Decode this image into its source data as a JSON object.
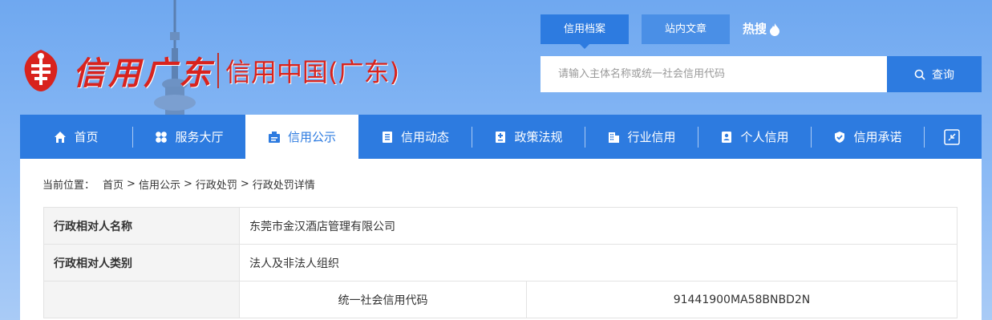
{
  "logo": {
    "main_text": "信用广东",
    "sub_text": "信用中国(广东)"
  },
  "search": {
    "tabs": [
      {
        "label": "信用档案",
        "active": true
      },
      {
        "label": "站内文章",
        "active": false
      }
    ],
    "hot_label": "热搜",
    "placeholder": "请输入主体名称或统一社会信用代码",
    "button_label": "查询"
  },
  "nav": {
    "items": [
      {
        "label": "首页",
        "icon": "home-icon"
      },
      {
        "label": "服务大厅",
        "icon": "grid-icon"
      },
      {
        "label": "信用公示",
        "icon": "announcement-icon",
        "active": true
      },
      {
        "label": "信用动态",
        "icon": "document-icon"
      },
      {
        "label": "政策法规",
        "icon": "law-icon"
      },
      {
        "label": "行业信用",
        "icon": "building-icon"
      },
      {
        "label": "个人信用",
        "icon": "id-card-icon"
      },
      {
        "label": "信用承诺",
        "icon": "shield-check-icon"
      }
    ],
    "expand_icon": "collapse-arrows-icon"
  },
  "breadcrumb": {
    "label": "当前位置：",
    "items": [
      "首页",
      "信用公示",
      "行政处罚",
      "行政处罚详情"
    ],
    "separator": ">"
  },
  "detail": {
    "row1": {
      "key": "行政相对人名称",
      "value": "东莞市金汉酒店管理有限公司"
    },
    "row2": {
      "key": "行政相对人类别",
      "value": "法人及非法人组织"
    },
    "row3": {
      "key": "",
      "sub_key": "统一社会信用代码",
      "value": "91441900MA58BNBD2N"
    }
  },
  "colors": {
    "primary": "#2d7be0",
    "logo_red": "#d8231e",
    "background": "#8bbaf5"
  }
}
